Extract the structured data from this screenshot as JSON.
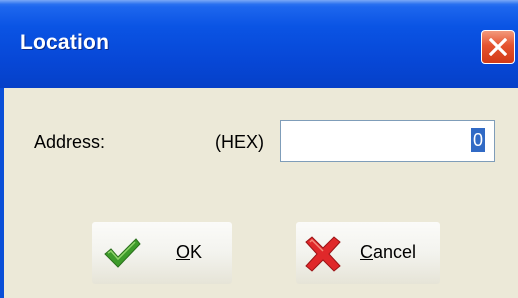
{
  "window": {
    "title": "Location"
  },
  "form": {
    "address_label": "Address:",
    "hex_label": "(HEX)",
    "address_value": "0"
  },
  "buttons": {
    "ok_accel": "O",
    "ok_rest": "K",
    "cancel_accel": "C",
    "cancel_rest": "ancel"
  },
  "icons": {
    "ok": "checkmark-icon",
    "cancel": "red-x-icon",
    "close": "close-icon"
  },
  "colors": {
    "titlebar": "#0a54e4",
    "close_button": "#e5532f",
    "dialog_face": "#ece9d8",
    "selection": "#316ac5",
    "checkmark": "#3d9b2a",
    "cross": "#e0282a"
  }
}
